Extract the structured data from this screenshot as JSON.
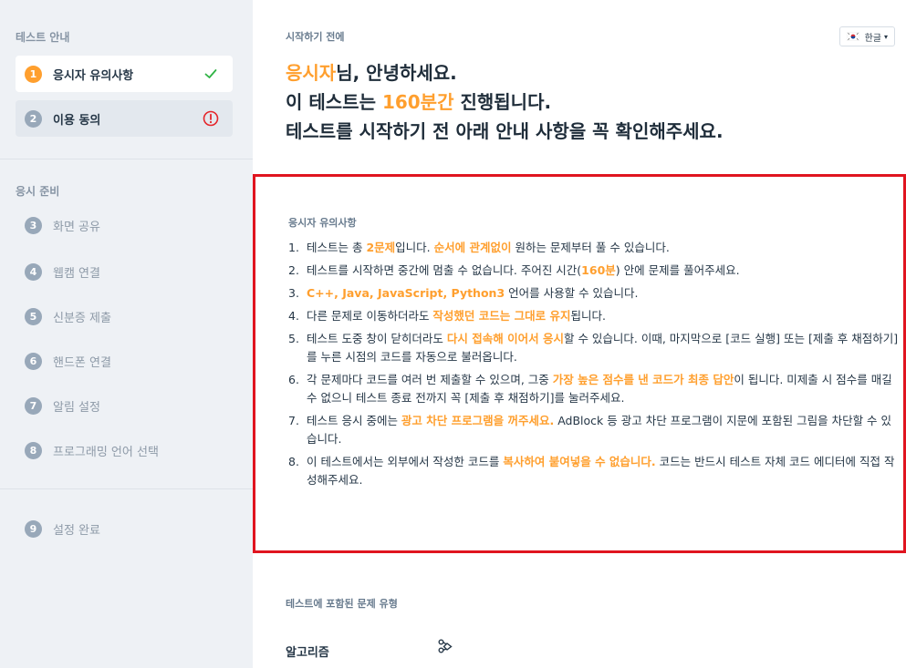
{
  "sidebar": {
    "sections": [
      {
        "title": "테스트 안내"
      },
      {
        "title": "응시 준비"
      }
    ],
    "guide_items": [
      {
        "num": "1",
        "label": "응시자 유의사항",
        "status": "done"
      },
      {
        "num": "2",
        "label": "이용 동의",
        "status": "warning"
      }
    ],
    "prep_items": [
      {
        "num": "3",
        "label": "화면 공유"
      },
      {
        "num": "4",
        "label": "웹캠 연결"
      },
      {
        "num": "5",
        "label": "신분증 제출"
      },
      {
        "num": "6",
        "label": "핸드폰 연결"
      },
      {
        "num": "7",
        "label": "알림 설정"
      },
      {
        "num": "8",
        "label": "프로그래밍 언어 선택"
      }
    ],
    "final_item": {
      "num": "9",
      "label": "설정 완료"
    }
  },
  "main": {
    "crumb": "시작하기 전에",
    "language": {
      "label": "한글",
      "flag": "korea-flag-icon"
    },
    "hero": {
      "line1_hl": "응시자",
      "line1_rest": "님, 안녕하세요.",
      "line2_pre": "이 테스트는 ",
      "line2_hl": "160분간",
      "line2_post": " 진행됩니다.",
      "line3": "테스트를 시작하기 전 아래 안내 사항을 꼭 확인해주세요."
    },
    "notice": {
      "title": "응시자 유의사항",
      "items": [
        {
          "num": "1.",
          "p1": "테스트는 총 ",
          "h1": "2문제",
          "p2": "입니다. ",
          "h2": "순서에 관계없이",
          "p3": " 원하는 문제부터 풀 수 있습니다."
        },
        {
          "num": "2.",
          "p1": "테스트를 시작하면 중간에 멈출 수 없습니다. 주어진 시간(",
          "h1": "160분",
          "p2": ") 안에 문제를 풀어주세요."
        },
        {
          "num": "3.",
          "h1": "C++, Java, JavaScript, Python3",
          "p2": " 언어를 사용할 수 있습니다."
        },
        {
          "num": "4.",
          "p1": "다른 문제로 이동하더라도 ",
          "h1": "작성했던 코드는 그대로 유지",
          "p2": "됩니다."
        },
        {
          "num": "5.",
          "p1": "테스트 도중 창이 닫히더라도 ",
          "h1": "다시 접속해 이어서 응시",
          "p2": "할 수 있습니다. 이때, 마지막으로 [코드 실행] 또는 [제출 후 채점하기]를 누른 시점의 코드를 자동으로 불러옵니다."
        },
        {
          "num": "6.",
          "p1": "각 문제마다 코드를 여러 번 제출할 수 있으며, 그중 ",
          "h1": "가장 높은 점수를 낸 코드가 최종 답안",
          "p2": "이 됩니다. 미제출 시 점수를 매길 수 없으니 테스트 종료 전까지 꼭 [제출 후 채점하기]를 눌러주세요."
        },
        {
          "num": "7.",
          "p1": "테스트 응시 중에는 ",
          "h1": "광고 차단 프로그램을 꺼주세요.",
          "p2": " AdBlock 등 광고 차단 프로그램이 지문에 포함된 그림을 차단할 수 있습니다."
        },
        {
          "num": "8.",
          "p1": "이 테스트에서는 외부에서 작성한 코드를 ",
          "h1": "복사하여 붙여넣을 수 없습니다.",
          "p2": " 코드는 반드시 테스트 자체 코드 에디터에 직접 작성해주세요."
        }
      ]
    },
    "types": {
      "title": "테스트에 포함된 문제 유형",
      "items": [
        {
          "label": "알고리즘",
          "icon": "algorithm-icon"
        }
      ]
    }
  },
  "colors": {
    "accent": "#ff9f2e",
    "highlight_border": "#e0141f",
    "success": "#2fb344",
    "warning": "#e5252a"
  }
}
